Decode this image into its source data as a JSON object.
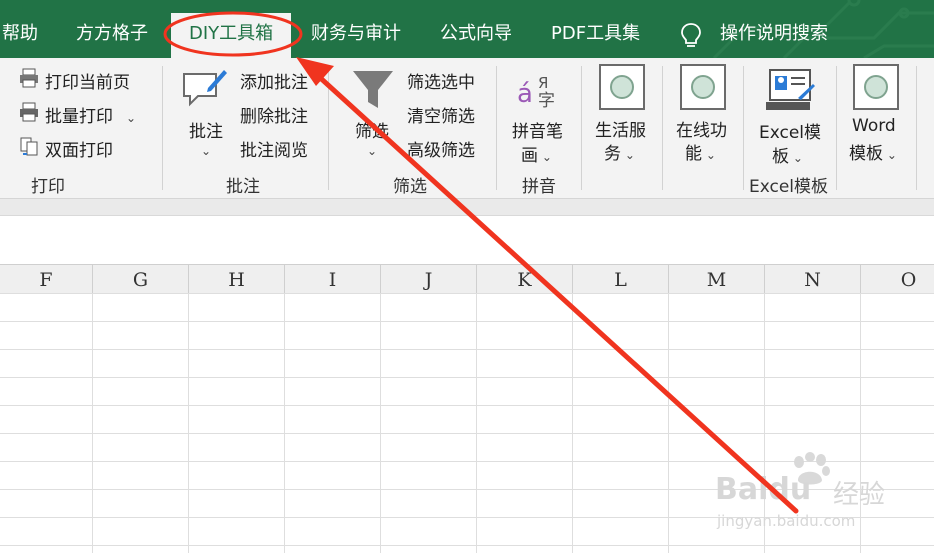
{
  "tabs": [
    {
      "label": "帮助"
    },
    {
      "label": "方方格子"
    },
    {
      "label": "DIY工具箱",
      "active": true
    },
    {
      "label": "财务与审计"
    },
    {
      "label": "公式向导"
    },
    {
      "label": "PDF工具集"
    }
  ],
  "search_label": "操作说明搜索",
  "ribbon": {
    "print": {
      "current_page": "打印当前页",
      "batch_print": "批量打印",
      "duplex_print": "双面打印",
      "group": "打印"
    },
    "comment": {
      "main": "批注",
      "add": "添加批注",
      "delete": "删除批注",
      "browse": "批注阅览",
      "group": "批注"
    },
    "filter": {
      "main": "筛选",
      "select_filter": "筛选选中",
      "clear_filter": "清空筛选",
      "advanced_filter": "高级筛选",
      "group": "筛选"
    },
    "pinyin": {
      "main_line1": "拼音笔",
      "main_line2": "画",
      "group": "拼音"
    },
    "life_service": {
      "line1": "生活服",
      "line2": "务"
    },
    "online_function": {
      "line1": "在线功",
      "line2": "能"
    },
    "excel_template": {
      "line1": "Excel模",
      "line2": "板",
      "group": "Excel模板"
    },
    "word_template": {
      "line1": "Word",
      "line2": "模板"
    }
  },
  "columns": [
    "F",
    "G",
    "H",
    "I",
    "J",
    "K",
    "L",
    "M",
    "N",
    "O"
  ],
  "colors": {
    "tabbar": "#217346",
    "ribbon": "#f3f3f3",
    "annotation": "#f0341f"
  },
  "watermark": {
    "brand": "Baidu",
    "brand_cn": "经验",
    "url": "jingyan.baidu.com"
  }
}
